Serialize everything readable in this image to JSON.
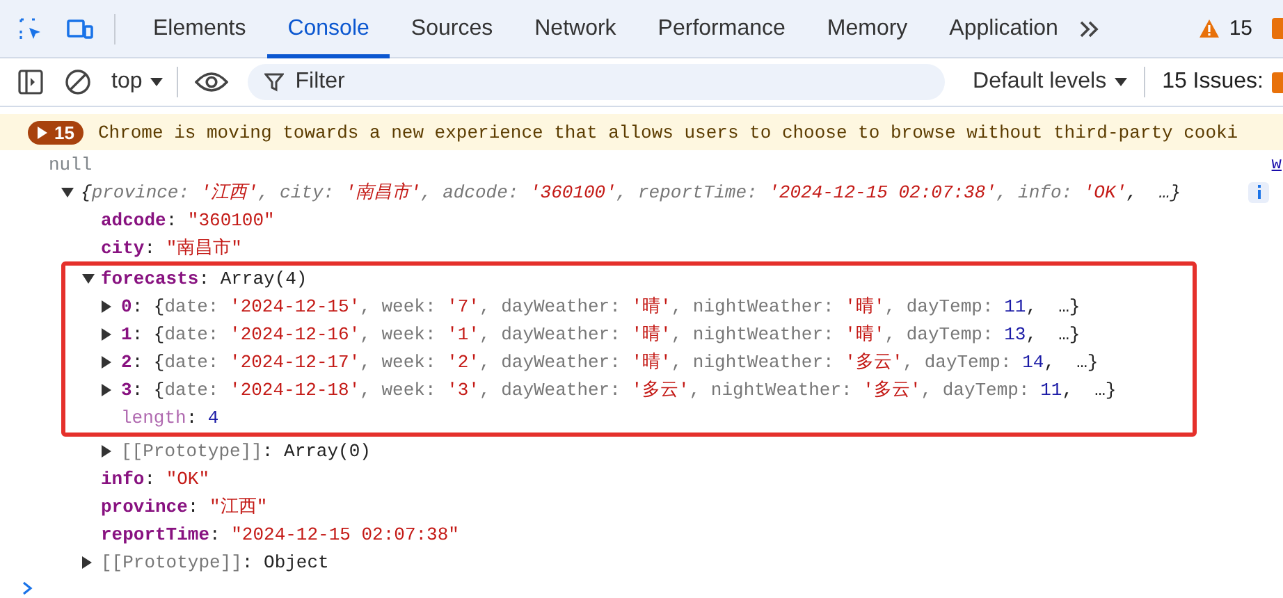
{
  "toolbar": {
    "tabs": [
      {
        "label": "Elements",
        "selected": false
      },
      {
        "label": "Console",
        "selected": true
      },
      {
        "label": "Sources",
        "selected": false
      },
      {
        "label": "Network",
        "selected": false
      },
      {
        "label": "Performance",
        "selected": false
      },
      {
        "label": "Memory",
        "selected": false
      },
      {
        "label": "Application",
        "selected": false
      }
    ],
    "warnings": "15"
  },
  "console_toolbar": {
    "context": "top",
    "filter": {
      "placeholder": "Filter"
    },
    "levels": "Default levels",
    "issues": "15 Issues:"
  },
  "messages": [
    {
      "kind": "warning",
      "count": "15",
      "text": "Chrome is moving towards a new experience that allows users to choose to browse without third-party cooki"
    },
    {
      "kind": "log",
      "text": "null",
      "source": "w"
    },
    {
      "kind": "object",
      "expanded": true,
      "italic": true,
      "parts": [
        {
          "kind": "plain",
          "text": "{"
        },
        {
          "kind": "dim",
          "text": "province: "
        },
        {
          "kind": "str",
          "text": "'江西'"
        },
        {
          "kind": "dim",
          "text": ", city: "
        },
        {
          "kind": "str",
          "text": "'南昌市'"
        },
        {
          "kind": "dim",
          "text": ", adcode: "
        },
        {
          "kind": "str",
          "text": "'360100'"
        },
        {
          "kind": "dim",
          "text": ", reportTime: "
        },
        {
          "kind": "str",
          "text": "'2024-12-15 02:07:38'"
        },
        {
          "kind": "dim",
          "text": ", info: "
        },
        {
          "kind": "str",
          "text": "'OK'"
        },
        {
          "kind": "plain",
          "text": ",  …}"
        }
      ],
      "children": [
        {
          "parts": [
            {
              "kind": "key",
              "text": "adcode"
            },
            {
              "kind": "plain",
              "text": ": "
            },
            {
              "kind": "str",
              "text": "\"360100\""
            }
          ]
        },
        {
          "parts": [
            {
              "kind": "key",
              "text": "city"
            },
            {
              "kind": "plain",
              "text": ": "
            },
            {
              "kind": "str",
              "text": "\"南昌市\""
            }
          ]
        },
        {
          "expanded": true,
          "boxed": true,
          "parts": [
            {
              "kind": "key",
              "text": "forecasts"
            },
            {
              "kind": "plain",
              "text": ": Array(4)"
            }
          ],
          "children": [
            {
              "expanded": false,
              "parts": [
                {
                  "kind": "key",
                  "text": "0"
                },
                {
                  "kind": "plain",
                  "text": ": {"
                },
                {
                  "kind": "dim",
                  "text": "date: "
                },
                {
                  "kind": "str",
                  "text": "'2024-12-15'"
                },
                {
                  "kind": "dim",
                  "text": ", week: "
                },
                {
                  "kind": "str",
                  "text": "'7'"
                },
                {
                  "kind": "dim",
                  "text": ", dayWeather: "
                },
                {
                  "kind": "str",
                  "text": "'晴'"
                },
                {
                  "kind": "dim",
                  "text": ", nightWeather: "
                },
                {
                  "kind": "str",
                  "text": "'晴'"
                },
                {
                  "kind": "dim",
                  "text": ", dayTemp: "
                },
                {
                  "kind": "num",
                  "text": "11"
                },
                {
                  "kind": "plain",
                  "text": ",  …}"
                }
              ]
            },
            {
              "expanded": false,
              "parts": [
                {
                  "kind": "key",
                  "text": "1"
                },
                {
                  "kind": "plain",
                  "text": ": {"
                },
                {
                  "kind": "dim",
                  "text": "date: "
                },
                {
                  "kind": "str",
                  "text": "'2024-12-16'"
                },
                {
                  "kind": "dim",
                  "text": ", week: "
                },
                {
                  "kind": "str",
                  "text": "'1'"
                },
                {
                  "kind": "dim",
                  "text": ", dayWeather: "
                },
                {
                  "kind": "str",
                  "text": "'晴'"
                },
                {
                  "kind": "dim",
                  "text": ", nightWeather: "
                },
                {
                  "kind": "str",
                  "text": "'晴'"
                },
                {
                  "kind": "dim",
                  "text": ", dayTemp: "
                },
                {
                  "kind": "num",
                  "text": "13"
                },
                {
                  "kind": "plain",
                  "text": ",  …}"
                }
              ]
            },
            {
              "expanded": false,
              "parts": [
                {
                  "kind": "key",
                  "text": "2"
                },
                {
                  "kind": "plain",
                  "text": ": {"
                },
                {
                  "kind": "dim",
                  "text": "date: "
                },
                {
                  "kind": "str",
                  "text": "'2024-12-17'"
                },
                {
                  "kind": "dim",
                  "text": ", week: "
                },
                {
                  "kind": "str",
                  "text": "'2'"
                },
                {
                  "kind": "dim",
                  "text": ", dayWeather: "
                },
                {
                  "kind": "str",
                  "text": "'晴'"
                },
                {
                  "kind": "dim",
                  "text": ", nightWeather: "
                },
                {
                  "kind": "str",
                  "text": "'多云'"
                },
                {
                  "kind": "dim",
                  "text": ", dayTemp: "
                },
                {
                  "kind": "num",
                  "text": "14"
                },
                {
                  "kind": "plain",
                  "text": ",  …}"
                }
              ]
            },
            {
              "expanded": false,
              "parts": [
                {
                  "kind": "key",
                  "text": "3"
                },
                {
                  "kind": "plain",
                  "text": ": {"
                },
                {
                  "kind": "dim",
                  "text": "date: "
                },
                {
                  "kind": "str",
                  "text": "'2024-12-18'"
                },
                {
                  "kind": "dim",
                  "text": ", week: "
                },
                {
                  "kind": "str",
                  "text": "'3'"
                },
                {
                  "kind": "dim",
                  "text": ", dayWeather: "
                },
                {
                  "kind": "str",
                  "text": "'多云'"
                },
                {
                  "kind": "dim",
                  "text": ", nightWeather: "
                },
                {
                  "kind": "str",
                  "text": "'多云'"
                },
                {
                  "kind": "dim",
                  "text": ", dayTemp: "
                },
                {
                  "kind": "num",
                  "text": "11"
                },
                {
                  "kind": "plain",
                  "text": ",  …}"
                }
              ]
            },
            {
              "parts": [
                {
                  "kind": "lightkey",
                  "text": "length"
                },
                {
                  "kind": "plain",
                  "text": ": "
                },
                {
                  "kind": "num",
                  "text": "4"
                }
              ]
            },
            {
              "kind": "prototype",
              "expanded": false,
              "parts": [
                {
                  "kind": "dim",
                  "text": "[[Prototype]]"
                },
                {
                  "kind": "plain",
                  "text": ": Array(0)"
                }
              ]
            }
          ]
        },
        {
          "parts": [
            {
              "kind": "key",
              "text": "info"
            },
            {
              "kind": "plain",
              "text": ": "
            },
            {
              "kind": "str",
              "text": "\"OK\""
            }
          ]
        },
        {
          "parts": [
            {
              "kind": "key",
              "text": "province"
            },
            {
              "kind": "plain",
              "text": ": "
            },
            {
              "kind": "str",
              "text": "\"江西\""
            }
          ]
        },
        {
          "parts": [
            {
              "kind": "key",
              "text": "reportTime"
            },
            {
              "kind": "plain",
              "text": ": "
            },
            {
              "kind": "str",
              "text": "\"2024-12-15 02:07:38\""
            }
          ]
        },
        {
          "expanded": false,
          "parts": [
            {
              "kind": "dim",
              "text": "[[Prototype]]"
            },
            {
              "kind": "plain",
              "text": ": Object"
            }
          ]
        }
      ]
    }
  ]
}
